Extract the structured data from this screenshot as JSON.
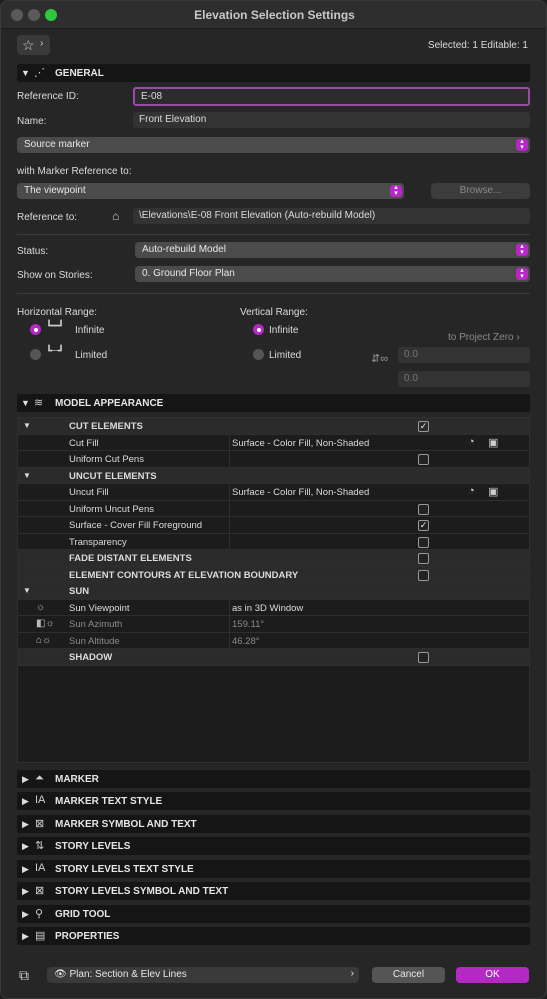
{
  "window": {
    "title": "Elevation Selection Settings"
  },
  "header": {
    "selected_info": "Selected: 1 Editable: 1"
  },
  "general": {
    "title": "GENERAL",
    "reference_id_label": "Reference ID:",
    "reference_id_value": "E-08",
    "name_label": "Name:",
    "name_value": "Front Elevation",
    "source_marker": "Source marker",
    "with_marker_reference_label": "with Marker Reference to:",
    "marker_reference_value": "The viewpoint",
    "browse_label": "Browse...",
    "reference_to_label": "Reference to:",
    "reference_to_value": "\\Elevations\\E-08 Front Elevation (Auto-rebuild Model)",
    "status_label": "Status:",
    "status_value": "Auto-rebuild Model",
    "show_on_stories_label": "Show on Stories:",
    "show_on_stories_value": "0. Ground Floor Plan",
    "horizontal_range_label": "Horizontal Range:",
    "horizontal_infinite": "Infinite",
    "horizontal_limited": "Limited",
    "vertical_range_label": "Vertical Range:",
    "vertical_infinite": "Infinite",
    "vertical_limited": "Limited",
    "to_project_zero": "to Project Zero",
    "vertical_top": "0.0",
    "vertical_bottom": "0.0"
  },
  "model_appearance": {
    "title": "MODEL APPEARANCE",
    "rows": [
      {
        "label": "CUT ELEMENTS",
        "value": "",
        "checked": true
      },
      {
        "label": "Cut Fill",
        "value": "Surface - Color Fill, Non-Shaded"
      },
      {
        "label": "Uniform Cut Pens",
        "value": "",
        "checked": false
      },
      {
        "label": "UNCUT ELEMENTS",
        "value": ""
      },
      {
        "label": "Uncut Fill",
        "value": "Surface - Color Fill, Non-Shaded"
      },
      {
        "label": "Uniform Uncut Pens",
        "value": "",
        "checked": false
      },
      {
        "label": "Surface - Cover Fill Foreground",
        "value": "",
        "checked": true
      },
      {
        "label": "Transparency",
        "value": "",
        "checked": false
      },
      {
        "label": "FADE DISTANT ELEMENTS",
        "value": "",
        "checked": false
      },
      {
        "label": "ELEMENT CONTOURS AT ELEVATION BOUNDARY",
        "value": "",
        "checked": false
      },
      {
        "label": "SUN",
        "value": ""
      },
      {
        "label": "Sun Viewpoint",
        "value": "as in 3D Window"
      },
      {
        "label": "Sun Azimuth",
        "value": "159.11°"
      },
      {
        "label": "Sun Altitude",
        "value": "46.28°"
      },
      {
        "label": "SHADOW",
        "value": "",
        "checked": false
      }
    ]
  },
  "collapsed_sections": [
    "MARKER",
    "MARKER TEXT STYLE",
    "MARKER SYMBOL AND TEXT",
    "STORY LEVELS",
    "STORY LEVELS TEXT STYLE",
    "STORY LEVELS SYMBOL AND TEXT",
    "GRID TOOL",
    "PROPERTIES"
  ],
  "footer": {
    "layer_value": "Plan: Section & Elev Lines",
    "cancel_label": "Cancel",
    "ok_label": "OK"
  },
  "colors": {
    "accent": "#b429c4",
    "background": "#262626"
  }
}
